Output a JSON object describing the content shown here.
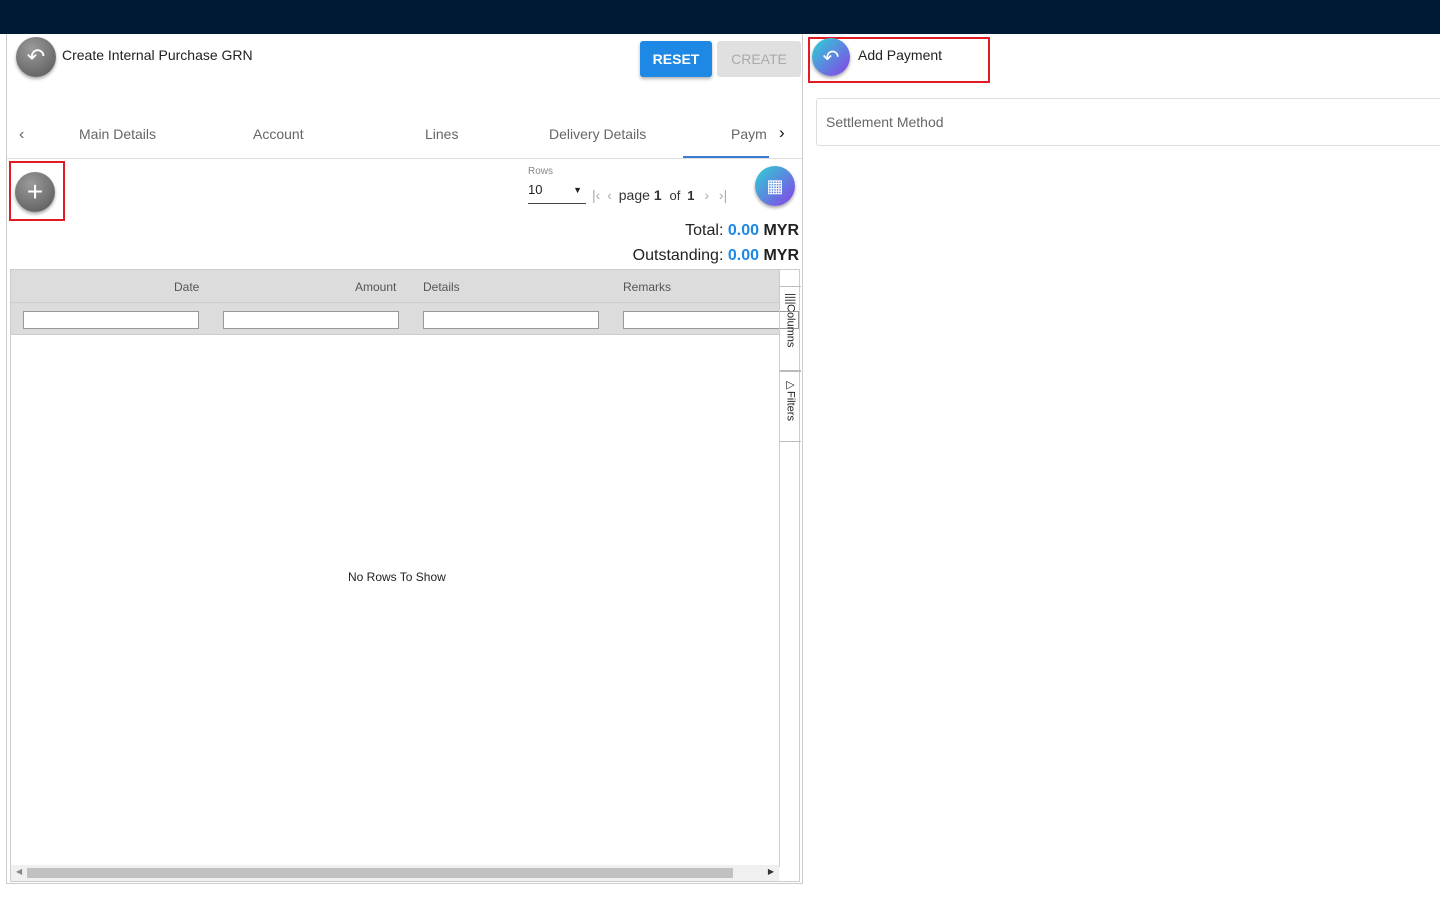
{
  "header": {
    "title": "Create Internal Purchase GRN",
    "reset": "RESET",
    "create": "CREATE"
  },
  "tabs": [
    "Main Details",
    "Account",
    "Lines",
    "Delivery Details",
    "Paym"
  ],
  "pager": {
    "rows_label": "Rows",
    "rows_value": "10",
    "page_word": "page",
    "page": "1",
    "of_word": "of",
    "total_pages": "1"
  },
  "totals": {
    "total_label": "Total:",
    "total_value": "0.00",
    "outstanding_label": "Outstanding:",
    "outstanding_value": "0.00",
    "currency": "MYR"
  },
  "grid": {
    "columns": [
      "Date",
      "Amount",
      "Details",
      "Remarks"
    ],
    "empty": "No Rows To Show",
    "side_tabs": [
      "Columns",
      "Filters"
    ]
  },
  "payment": {
    "title": "Add Payment",
    "settlement_placeholder": "Settlement Method"
  }
}
